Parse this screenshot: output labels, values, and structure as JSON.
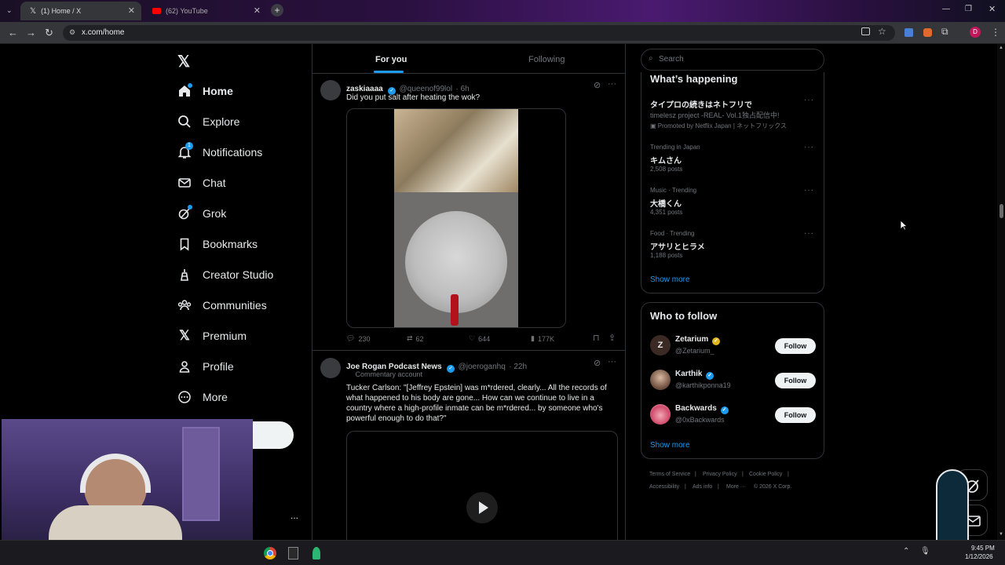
{
  "browser": {
    "tabs": [
      {
        "title": "(1) Home / X",
        "active": true
      },
      {
        "title": "(62) YouTube",
        "active": false
      }
    ],
    "url": "x.com/home",
    "profile_initial": "D"
  },
  "nav": {
    "items": [
      {
        "label": "Home",
        "icon": "home-icon"
      },
      {
        "label": "Explore",
        "icon": "search-icon"
      },
      {
        "label": "Notifications",
        "icon": "bell-icon",
        "badge": "1"
      },
      {
        "label": "Chat",
        "icon": "mail-icon"
      },
      {
        "label": "Grok",
        "icon": "grok-icon"
      },
      {
        "label": "Bookmarks",
        "icon": "bookmark-icon"
      },
      {
        "label": "Creator Studio",
        "icon": "creator-studio-icon"
      },
      {
        "label": "Communities",
        "icon": "communities-icon"
      },
      {
        "label": "Premium",
        "icon": "x-logo-icon"
      },
      {
        "label": "Profile",
        "icon": "person-icon"
      },
      {
        "label": "More",
        "icon": "more-circle-icon"
      }
    ],
    "account_dots": "..."
  },
  "feed": {
    "tabs": [
      "For you",
      "Following"
    ],
    "posts": [
      {
        "name": "zaskiaaaa",
        "handle": "@queenof99lol",
        "time": "· 6h",
        "text": "Did you put salt after heating the wok?",
        "stats": {
          "replies": "230",
          "reposts": "62",
          "likes": "644",
          "views": "177K"
        }
      },
      {
        "name": "Joe Rogan Podcast News",
        "handle": "@joeroganhq",
        "time": "· 22h",
        "label": "Commentary account",
        "text": "Tucker Carlson: \"[Jeffrey Epstein] was m*rdered, clearly... All the records of what happened to his body are gone... How can we continue to live in a country where a high-profile inmate can be m*rdered... by someone who's powerful enough to do that?\""
      }
    ]
  },
  "sidebar": {
    "search_placeholder": "Search",
    "happening": {
      "title": "What’s happening",
      "trends": [
        {
          "meta": "",
          "title": "タイプロの続きはネトフリで",
          "sub": "timelesz project -REAL- Vol.1独占配信中!",
          "promo": "Promoted by Netflix Japan | ネットフリックス"
        },
        {
          "meta": "Trending in Japan",
          "title": "キムさん",
          "sub": "2,508 posts"
        },
        {
          "meta": "Music · Trending",
          "title": "大橋くん",
          "sub": "4,351 posts"
        },
        {
          "meta": "Food · Trending",
          "title": "アサリとヒラメ",
          "sub": "1,188 posts"
        }
      ],
      "show_more": "Show more"
    },
    "who_to_follow": {
      "title": "Who to follow",
      "accounts": [
        {
          "name": "Zetarium",
          "handle": "@Zetarium_",
          "verified": "gold"
        },
        {
          "name": "Karthik",
          "handle": "@karthikponna19",
          "verified": "blue"
        },
        {
          "name": "Backwards",
          "handle": "@0xBackwards",
          "verified": "blue"
        }
      ],
      "follow_label": "Follow",
      "show_more": "Show more"
    },
    "footer": [
      "Terms of Service",
      "Privacy Policy",
      "Cookie Policy",
      "Accessibility",
      "Ads info",
      "More ···",
      "© 2026 X Corp."
    ]
  },
  "taskbar": {
    "time": "9:45 PM",
    "date": "1/12/2026"
  },
  "colors": {
    "accent": "#1d9bf0",
    "background": "#000000",
    "border": "#2f3336",
    "muted_text": "#71767b"
  }
}
